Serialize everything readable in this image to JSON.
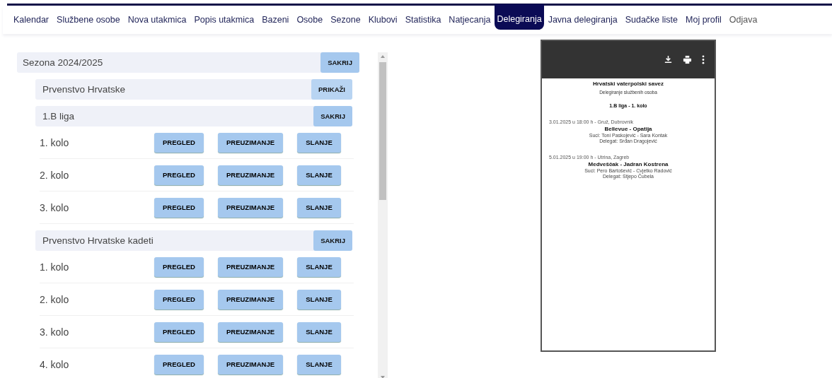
{
  "nav": [
    {
      "label": "Kalendar",
      "selected": false
    },
    {
      "label": "Službene osobe",
      "selected": false
    },
    {
      "label": "Nova utakmica",
      "selected": false
    },
    {
      "label": "Popis utakmica",
      "selected": false
    },
    {
      "label": "Bazeni",
      "selected": false
    },
    {
      "label": "Osobe",
      "selected": false
    },
    {
      "label": "Sezone",
      "selected": false
    },
    {
      "label": "Klubovi",
      "selected": false
    },
    {
      "label": "Statistika",
      "selected": false
    },
    {
      "label": "Natjecanja",
      "selected": false
    },
    {
      "label": "Delegiranja",
      "selected": true
    },
    {
      "label": "Javna delegiranja",
      "selected": false
    },
    {
      "label": "Sudačke liste",
      "selected": false
    },
    {
      "label": "Moj profil",
      "selected": false
    },
    {
      "label": "Odjava",
      "selected": false
    }
  ],
  "season": {
    "title": "Sezona 2024/2025",
    "button": "SAKRIJ",
    "expanded": true,
    "competitions": [
      {
        "title": "Prvenstvo Hrvatske",
        "button": "PRIKAŽI",
        "expanded": false
      },
      {
        "title": "1.B liga",
        "button": "SAKRIJ",
        "expanded": true,
        "rounds": [
          {
            "name": "1. kolo",
            "buttons": [
              "PREGLED",
              "PREUZIMANJE",
              "SLANJE"
            ]
          },
          {
            "name": "2. kolo",
            "buttons": [
              "PREGLED",
              "PREUZIMANJE",
              "SLANJE"
            ]
          },
          {
            "name": "3. kolo",
            "buttons": [
              "PREGLED",
              "PREUZIMANJE",
              "SLANJE"
            ]
          }
        ]
      },
      {
        "title": "Prvenstvo Hrvatske kadeti",
        "button": "SAKRIJ",
        "expanded": true,
        "rounds": [
          {
            "name": "1. kolo",
            "buttons": [
              "PREGLED",
              "PREUZIMANJE",
              "SLANJE"
            ]
          },
          {
            "name": "2. kolo",
            "buttons": [
              "PREGLED",
              "PREUZIMANJE",
              "SLANJE"
            ]
          },
          {
            "name": "3. kolo",
            "buttons": [
              "PREGLED",
              "PREUZIMANJE",
              "SLANJE"
            ]
          },
          {
            "name": "4. kolo",
            "buttons": [
              "PREGLED",
              "PREUZIMANJE",
              "SLANJE"
            ]
          }
        ]
      }
    ]
  },
  "document": {
    "title": "Hrvatski vaterpolski savez",
    "subtitle": "Delegiranje službenih osoba",
    "heading": "1.B liga - 1. kolo",
    "matches": [
      {
        "info": "3.01.2025 u 18:00 h - Gruž, Dubrovnik",
        "teams": "Bellevue - Opatija",
        "referees": "Suci: Toni Paskojević - Sara Kontak",
        "delegate": "Delegat: Srđan Dragojević"
      },
      {
        "info": "5.01.2025 u 19:00 h - Utrina, Zagreb",
        "teams": "Medveščak - Jadran Kostrena",
        "referees": "Suci: Pero Bartošević - Cvjetko Radović",
        "delegate": "Delegat: Stjepo Čubela"
      }
    ]
  }
}
